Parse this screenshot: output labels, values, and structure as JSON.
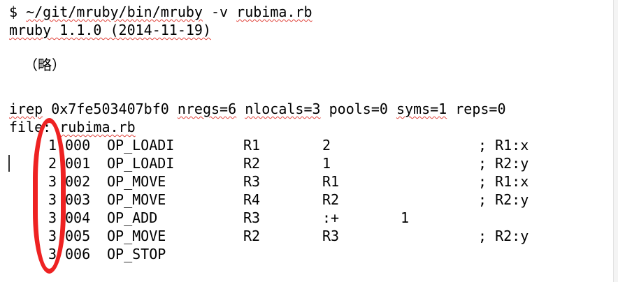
{
  "terminal": {
    "prompt_symbol": "$",
    "command_path": "~/git/mruby/bin/mruby",
    "command_flag": "-v",
    "command_arg": "rubima.rb",
    "version_line": "mruby 1.1.0 (2014-11-19)",
    "omitted_note": "（略）",
    "irep": {
      "word": "irep",
      "address": "0x7fe503407bf0",
      "nregs": "nregs=6",
      "nlocals": "nlocals=3",
      "pools": "pools=0",
      "syms": "syms=1",
      "reps": "reps=0"
    },
    "file_label": "file:",
    "file_name": "rubima.rb",
    "instructions": [
      {
        "line": "1",
        "index": "000",
        "op": "OP_LOADI",
        "a": "R1",
        "b": "2",
        "c": "",
        "comment": "; R1:x"
      },
      {
        "line": "2",
        "index": "001",
        "op": "OP_LOADI",
        "a": "R2",
        "b": "1",
        "c": "",
        "comment": "; R2:y"
      },
      {
        "line": "3",
        "index": "002",
        "op": "OP_MOVE",
        "a": "R3",
        "b": "R1",
        "c": "",
        "comment": "; R1:x"
      },
      {
        "line": "3",
        "index": "003",
        "op": "OP_MOVE",
        "a": "R4",
        "b": "R2",
        "c": "",
        "comment": "; R2:y"
      },
      {
        "line": "3",
        "index": "004",
        "op": "OP_ADD",
        "a": "R3",
        "b": ":+",
        "c": "1",
        "comment": ""
      },
      {
        "line": "3",
        "index": "005",
        "op": "OP_MOVE",
        "a": "R2",
        "b": "R3",
        "c": "",
        "comment": "; R2:y"
      },
      {
        "line": "3",
        "index": "006",
        "op": "OP_STOP",
        "a": "",
        "b": "",
        "c": "",
        "comment": ""
      }
    ]
  },
  "annotation": {
    "color": "#ee2222",
    "shape": "ellipse"
  }
}
